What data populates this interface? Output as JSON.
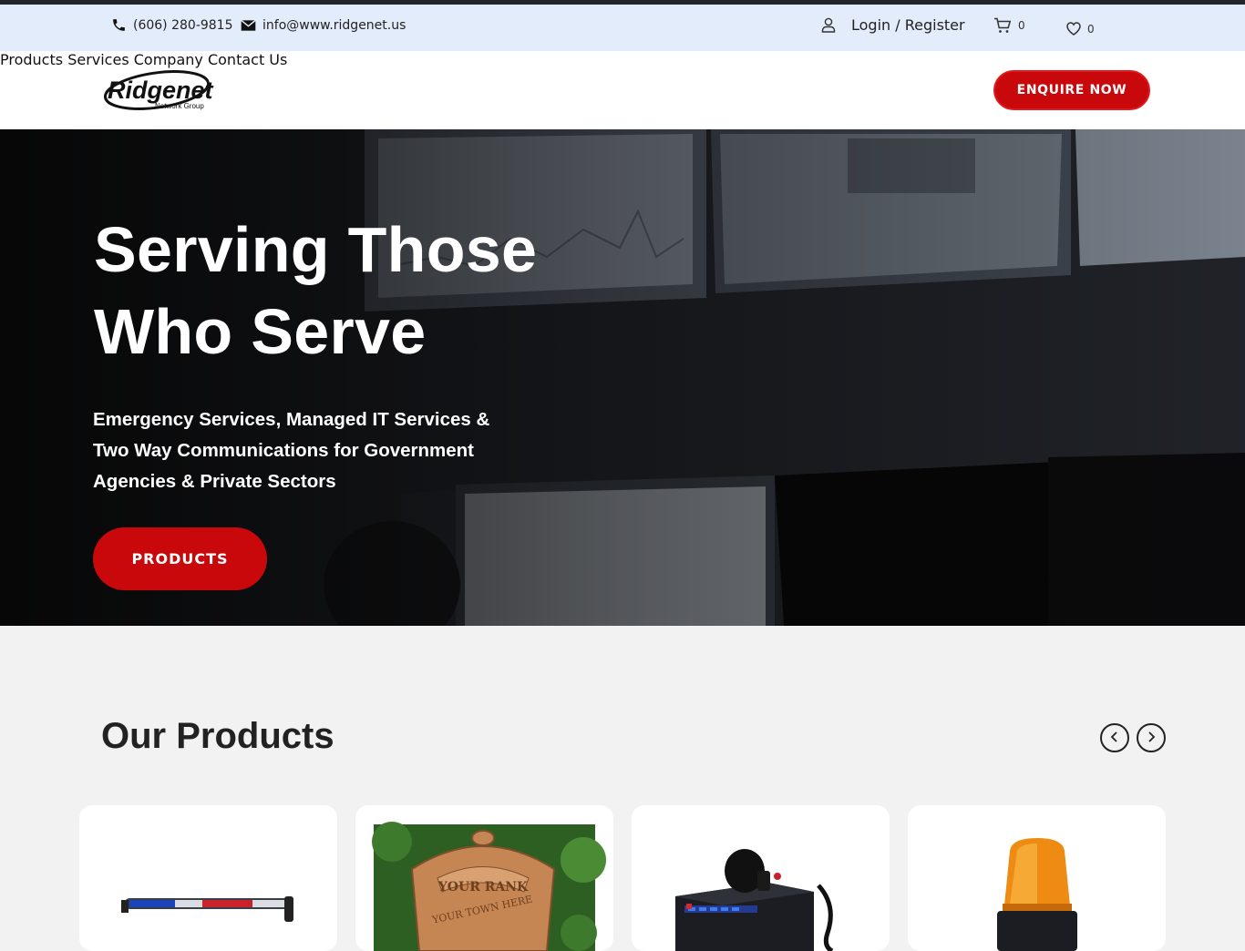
{
  "topbar": {
    "phone": "(606) 280-9815",
    "email": "info@www.ridgenet.us",
    "login": "Login / Register",
    "cart_count": "0",
    "wishlist_count": "0"
  },
  "header": {
    "logo_text": "Ridgenet",
    "logo_tagline": "Network Group",
    "nav": [
      "Products",
      "Services",
      "Company",
      "Contact Us"
    ],
    "cta": "ENQUIRE NOW"
  },
  "hero": {
    "title_line1": "Serving Those",
    "title_line2": "Who Serve",
    "subtitle_line1": "Emergency Services, Managed IT Services &",
    "subtitle_line2": "Two Way Communications for Government",
    "subtitle_line3": "Agencies & Private Sectors",
    "button": "PRODUCTS"
  },
  "products": {
    "title": "Our Products",
    "badge_text_1": "YOUR RANK",
    "badge_text_2": "YOUR TOWN HERE"
  },
  "colors": {
    "accent": "#c8080b",
    "topbar_bg": "#e3ecfa",
    "page_bg": "#f2f2f2"
  },
  "icons": [
    "phone-icon",
    "mail-icon",
    "user-icon",
    "cart-icon",
    "heart-icon",
    "chevron-left-icon",
    "chevron-right-icon"
  ]
}
